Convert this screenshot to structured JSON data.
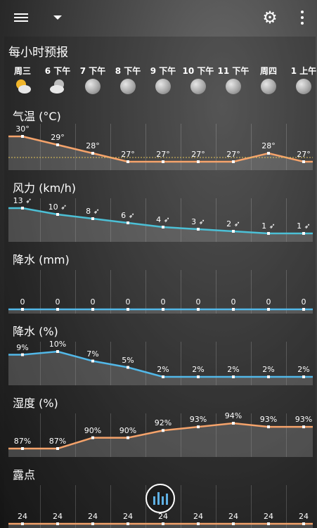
{
  "title": "每小时预报",
  "hours": [
    {
      "label": "周三",
      "icon": "partly-cloudy-sun-icon"
    },
    {
      "label": "6 下午",
      "icon": "cloudy-moon-icon"
    },
    {
      "label": "7 下午",
      "icon": "moon-icon"
    },
    {
      "label": "8 下午",
      "icon": "moon-icon"
    },
    {
      "label": "9 下午",
      "icon": "moon-icon"
    },
    {
      "label": "10 下午",
      "icon": "moon-icon"
    },
    {
      "label": "11 下午",
      "icon": "moon-icon"
    },
    {
      "label": "周四",
      "icon": "moon-icon"
    },
    {
      "label": "1 上午",
      "icon": "moon-icon"
    }
  ],
  "sections": [
    {
      "key": "temp",
      "title": "气温 (°C)",
      "values": [
        "30°",
        "29°",
        "28°",
        "27°",
        "27°",
        "27°",
        "27°",
        "28°",
        "27°"
      ],
      "nums": [
        30,
        29,
        28,
        27,
        27,
        27,
        27,
        28,
        27
      ],
      "color": "#f5a36b",
      "fill": "#7a7a7a"
    },
    {
      "key": "wind",
      "title": "风力 (km/h)",
      "values": [
        "13",
        "10",
        "8",
        "6",
        "4",
        "3",
        "2",
        "1",
        "1"
      ],
      "nums": [
        13,
        10,
        8,
        6,
        4,
        3,
        2,
        1,
        1
      ],
      "color": "#4cc0d6",
      "fill": "#6f6f6f"
    },
    {
      "key": "precip_mm",
      "title": "降水 (mm)",
      "values": [
        "0",
        "0",
        "0",
        "0",
        "0",
        "0",
        "0",
        "0",
        "0"
      ],
      "nums": [
        0,
        0,
        0,
        0,
        0,
        0,
        0,
        0,
        0
      ],
      "color": "#52b8e8",
      "fill": "#6f6f6f"
    },
    {
      "key": "precip_pct",
      "title": "降水 (%)",
      "values": [
        "9%",
        "10%",
        "7%",
        "5%",
        "2%",
        "2%",
        "2%",
        "2%",
        "2%"
      ],
      "nums": [
        9,
        10,
        7,
        5,
        2,
        2,
        2,
        2,
        2
      ],
      "color": "#52b8e8",
      "fill": "#6f6f6f"
    },
    {
      "key": "humidity",
      "title": "湿度 (%)",
      "values": [
        "87%",
        "87%",
        "90%",
        "90%",
        "92%",
        "93%",
        "94%",
        "93%",
        "93%"
      ],
      "nums": [
        87,
        87,
        90,
        90,
        92,
        93,
        94,
        93,
        93
      ],
      "color": "#f5a36b",
      "fill": "#6f6f6f"
    },
    {
      "key": "dew",
      "title": "露点",
      "values": [
        "24",
        "24",
        "24",
        "24",
        "24",
        "24",
        "24",
        "24",
        "24"
      ],
      "nums": [
        24,
        24,
        24,
        24,
        24,
        24,
        24,
        24,
        24
      ],
      "color": "#f5a36b",
      "fill": "#6f6f6f"
    }
  ]
}
